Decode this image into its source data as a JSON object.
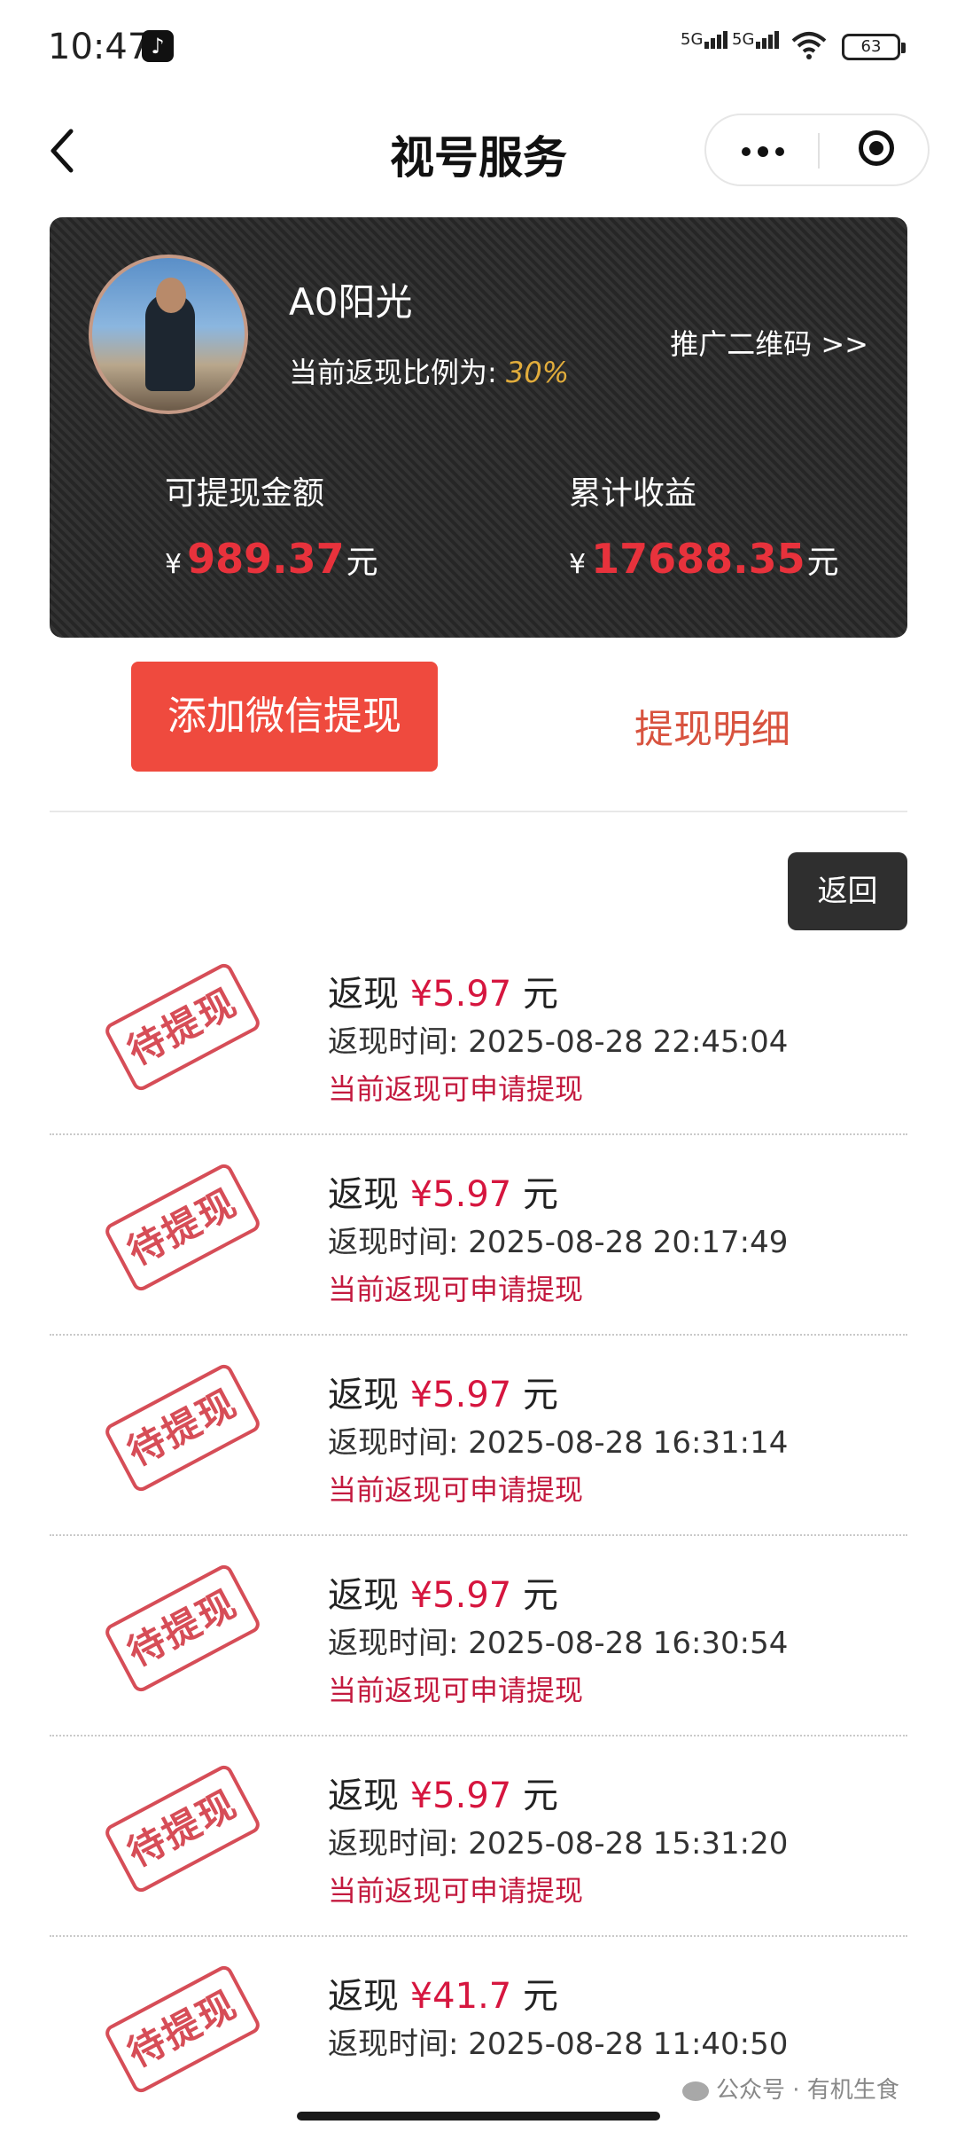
{
  "status_bar": {
    "time": "10:47",
    "signal1": "5G",
    "signal2": "5G",
    "battery": "63"
  },
  "nav": {
    "title": "视号服务"
  },
  "card": {
    "user_name": "A0阳光",
    "ratio_label": "当前返现比例为:",
    "ratio_value": "30%",
    "qr_link": "推广二维码 >>",
    "withdrawable_label": "可提现金额",
    "withdrawable_currency": "¥",
    "withdrawable_amount": "989.37",
    "withdrawable_unit": "元",
    "total_label": "累计收益",
    "total_currency": "¥",
    "total_amount": "17688.35",
    "total_unit": "元"
  },
  "actions": {
    "add_wechat": "添加微信提现",
    "detail": "提现明细",
    "return": "返回"
  },
  "records": [
    {
      "stamp": "待提现",
      "prefix": "返现",
      "amount": "¥5.97",
      "unit": "元",
      "time_label": "返现时间:",
      "time": "2025-08-28 22:45:04",
      "status": "当前返现可申请提现"
    },
    {
      "stamp": "待提现",
      "prefix": "返现",
      "amount": "¥5.97",
      "unit": "元",
      "time_label": "返现时间:",
      "time": "2025-08-28 20:17:49",
      "status": "当前返现可申请提现"
    },
    {
      "stamp": "待提现",
      "prefix": "返现",
      "amount": "¥5.97",
      "unit": "元",
      "time_label": "返现时间:",
      "time": "2025-08-28 16:31:14",
      "status": "当前返现可申请提现"
    },
    {
      "stamp": "待提现",
      "prefix": "返现",
      "amount": "¥5.97",
      "unit": "元",
      "time_label": "返现时间:",
      "time": "2025-08-28 16:30:54",
      "status": "当前返现可申请提现"
    },
    {
      "stamp": "待提现",
      "prefix": "返现",
      "amount": "¥5.97",
      "unit": "元",
      "time_label": "返现时间:",
      "time": "2025-08-28 15:31:20",
      "status": "当前返现可申请提现"
    },
    {
      "stamp": "待提现",
      "prefix": "返现",
      "amount": "¥41.7",
      "unit": "元",
      "time_label": "返现时间:",
      "time": "2025-08-28 11:40:50",
      "status": ""
    }
  ],
  "watermark": "公众号 · 有机生食",
  "colors": {
    "accent_red": "#ef4a3e",
    "amount_red": "#e8323c",
    "ratio_gold": "#e2ad3c",
    "stamp_red": "#d23a45"
  }
}
